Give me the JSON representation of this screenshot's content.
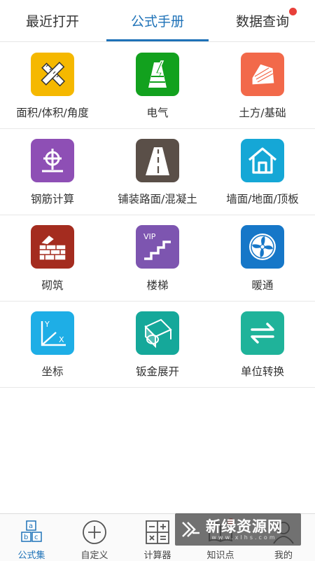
{
  "tabs": [
    {
      "label": "最近打开",
      "active": false,
      "has_badge": false
    },
    {
      "label": "公式手册",
      "active": true,
      "has_badge": false
    },
    {
      "label": "数据查询",
      "active": false,
      "has_badge": true
    }
  ],
  "grid": [
    {
      "label": "面积/体积/角度",
      "icon": "ruler-pencil-icon",
      "color": "#f5b800"
    },
    {
      "label": "电气",
      "icon": "electric-tower-icon",
      "color": "#12a11e"
    },
    {
      "label": "土方/基础",
      "icon": "excavator-icon",
      "color": "#f2694a"
    },
    {
      "label": "钢筋计算",
      "icon": "rebar-icon",
      "color": "#8e4fb5"
    },
    {
      "label": "铺装路面/混凝土",
      "icon": "road-icon",
      "color": "#5a4f48"
    },
    {
      "label": "墙面/地面/顶板",
      "icon": "house-icon",
      "color": "#15a7d6"
    },
    {
      "label": "砌筑",
      "icon": "brick-wall-icon",
      "color": "#a42c1f"
    },
    {
      "label": "楼梯",
      "icon": "stairs-icon",
      "color": "#7d55b0",
      "badge_text": "VIP"
    },
    {
      "label": "暖通",
      "icon": "fan-icon",
      "color": "#1677c8"
    },
    {
      "label": "坐标",
      "icon": "coordinate-axes-icon",
      "color": "#1eaee6",
      "axis_y": "Y",
      "axis_x": "X"
    },
    {
      "label": "钣金展开",
      "icon": "sheet-metal-icon",
      "color": "#15a89a"
    },
    {
      "label": "单位转换",
      "icon": "swap-arrows-icon",
      "color": "#1fb39a"
    }
  ],
  "bottom_nav": [
    {
      "label": "公式集",
      "icon": "formula-blocks-icon",
      "active": true,
      "has_badge": false,
      "block_letters": [
        "a",
        "b",
        "c"
      ]
    },
    {
      "label": "自定义",
      "icon": "plus-circle-icon",
      "active": false,
      "has_badge": false
    },
    {
      "label": "计算器",
      "icon": "calculator-icon",
      "active": false,
      "has_badge": false
    },
    {
      "label": "知识点",
      "icon": "book-icon",
      "active": false,
      "has_badge": true
    },
    {
      "label": "我的",
      "icon": "person-icon",
      "active": false,
      "has_badge": false
    }
  ],
  "watermark": {
    "text": "新绿资源网",
    "sub": "www.xlhs.com"
  },
  "colors": {
    "accent": "#1e72b8",
    "badge": "#e8403a"
  }
}
